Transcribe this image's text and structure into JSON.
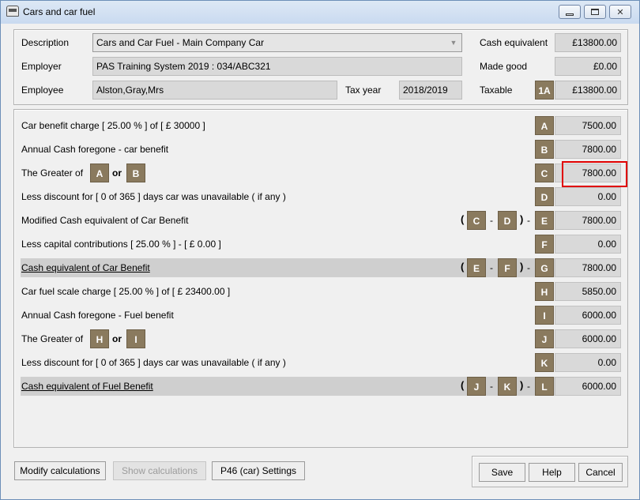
{
  "window": {
    "title": "Cars and car fuel"
  },
  "header": {
    "description_label": "Description",
    "description_value": "Cars and Car Fuel - Main Company Car",
    "employer_label": "Employer",
    "employer_value": "PAS Training System 2019 : 034/ABC321",
    "employee_label": "Employee",
    "employee_value": "Alston,Gray,Mrs",
    "tax_year_label": "Tax year",
    "tax_year_value": "2018/2019",
    "cash_equivalent_label": "Cash equivalent",
    "cash_equivalent_value": "£13800.00",
    "made_good_label": "Made good",
    "made_good_value": "£0.00",
    "taxable_label": "Taxable",
    "taxable_badge": "1A",
    "taxable_value": "£13800.00"
  },
  "rows": [
    {
      "label": "Car benefit charge [  25.00 % ] of [ £      30000 ]",
      "badge": "A",
      "value": "7500.00"
    },
    {
      "label": "Annual Cash foregone - car benefit",
      "badge": "B",
      "value": "7800.00"
    },
    {
      "label": "The Greater of",
      "ref1": "A",
      "or": "or",
      "ref2": "B",
      "badge": "C",
      "value": "7800.00"
    },
    {
      "label": "Less discount for [    0 of 365 ] days car was unavailable ( if any )",
      "badge": "D",
      "value": "0.00"
    },
    {
      "label": "Modified Cash equivalent of Car Benefit",
      "ref1": "C",
      "ref2": "D",
      "badge": "E",
      "value": "7800.00"
    },
    {
      "label": "Less capital contributions [  25.00 % ] - [ £       0.00 ]",
      "badge": "F",
      "value": "0.00"
    },
    {
      "label": "Cash equivalent of Car Benefit",
      "ref1": "E",
      "ref2": "F",
      "badge": "G",
      "value": "7800.00"
    },
    {
      "label": "Car fuel scale charge [  25.00 % ] of [  £   23400.00 ]",
      "badge": "H",
      "value": "5850.00"
    },
    {
      "label": "Annual Cash foregone - Fuel benefit",
      "badge": "I",
      "value": "6000.00"
    },
    {
      "label": "The Greater of",
      "ref1": "H",
      "or": "or",
      "ref2": "I",
      "badge": "J",
      "value": "6000.00"
    },
    {
      "label": "Less discount for [    0 of 365 ] days car was unavailable ( if any )",
      "badge": "K",
      "value": "0.00"
    },
    {
      "label": "Cash equivalent of Fuel Benefit",
      "ref1": "J",
      "ref2": "K",
      "badge": "L",
      "value": "6000.00"
    }
  ],
  "formula": {
    "open": "(",
    "minus": "-",
    "close": ")"
  },
  "footer": {
    "modify_label": "Modify calculations",
    "show_label": "Show calculations",
    "p46_label": "P46 (car) Settings",
    "save_label": "Save",
    "help_label": "Help",
    "cancel_label": "Cancel"
  },
  "icons": {
    "window_icon": "car-icon",
    "minimize": "minimize-icon",
    "maximize": "maximize-icon",
    "close": "close-icon",
    "dropdown": "chevron-down-icon"
  },
  "colors": {
    "badge": "#8a7a5e",
    "field": "#d9d9d9",
    "highlight": "#e00000"
  }
}
